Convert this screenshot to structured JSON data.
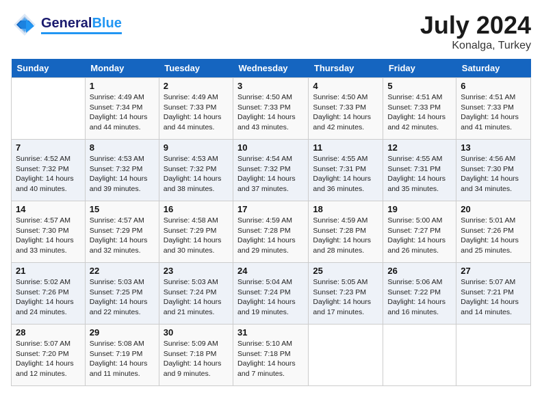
{
  "header": {
    "logo_general": "General",
    "logo_blue": "Blue",
    "month": "July 2024",
    "location": "Konalga, Turkey"
  },
  "days_of_week": [
    "Sunday",
    "Monday",
    "Tuesday",
    "Wednesday",
    "Thursday",
    "Friday",
    "Saturday"
  ],
  "weeks": [
    [
      {
        "day": "",
        "sunrise": "",
        "sunset": "",
        "daylight": ""
      },
      {
        "day": "1",
        "sunrise": "Sunrise: 4:49 AM",
        "sunset": "Sunset: 7:34 PM",
        "daylight": "Daylight: 14 hours and 44 minutes."
      },
      {
        "day": "2",
        "sunrise": "Sunrise: 4:49 AM",
        "sunset": "Sunset: 7:33 PM",
        "daylight": "Daylight: 14 hours and 44 minutes."
      },
      {
        "day": "3",
        "sunrise": "Sunrise: 4:50 AM",
        "sunset": "Sunset: 7:33 PM",
        "daylight": "Daylight: 14 hours and 43 minutes."
      },
      {
        "day": "4",
        "sunrise": "Sunrise: 4:50 AM",
        "sunset": "Sunset: 7:33 PM",
        "daylight": "Daylight: 14 hours and 42 minutes."
      },
      {
        "day": "5",
        "sunrise": "Sunrise: 4:51 AM",
        "sunset": "Sunset: 7:33 PM",
        "daylight": "Daylight: 14 hours and 42 minutes."
      },
      {
        "day": "6",
        "sunrise": "Sunrise: 4:51 AM",
        "sunset": "Sunset: 7:33 PM",
        "daylight": "Daylight: 14 hours and 41 minutes."
      }
    ],
    [
      {
        "day": "7",
        "sunrise": "Sunrise: 4:52 AM",
        "sunset": "Sunset: 7:32 PM",
        "daylight": "Daylight: 14 hours and 40 minutes."
      },
      {
        "day": "8",
        "sunrise": "Sunrise: 4:53 AM",
        "sunset": "Sunset: 7:32 PM",
        "daylight": "Daylight: 14 hours and 39 minutes."
      },
      {
        "day": "9",
        "sunrise": "Sunrise: 4:53 AM",
        "sunset": "Sunset: 7:32 PM",
        "daylight": "Daylight: 14 hours and 38 minutes."
      },
      {
        "day": "10",
        "sunrise": "Sunrise: 4:54 AM",
        "sunset": "Sunset: 7:32 PM",
        "daylight": "Daylight: 14 hours and 37 minutes."
      },
      {
        "day": "11",
        "sunrise": "Sunrise: 4:55 AM",
        "sunset": "Sunset: 7:31 PM",
        "daylight": "Daylight: 14 hours and 36 minutes."
      },
      {
        "day": "12",
        "sunrise": "Sunrise: 4:55 AM",
        "sunset": "Sunset: 7:31 PM",
        "daylight": "Daylight: 14 hours and 35 minutes."
      },
      {
        "day": "13",
        "sunrise": "Sunrise: 4:56 AM",
        "sunset": "Sunset: 7:30 PM",
        "daylight": "Daylight: 14 hours and 34 minutes."
      }
    ],
    [
      {
        "day": "14",
        "sunrise": "Sunrise: 4:57 AM",
        "sunset": "Sunset: 7:30 PM",
        "daylight": "Daylight: 14 hours and 33 minutes."
      },
      {
        "day": "15",
        "sunrise": "Sunrise: 4:57 AM",
        "sunset": "Sunset: 7:29 PM",
        "daylight": "Daylight: 14 hours and 32 minutes."
      },
      {
        "day": "16",
        "sunrise": "Sunrise: 4:58 AM",
        "sunset": "Sunset: 7:29 PM",
        "daylight": "Daylight: 14 hours and 30 minutes."
      },
      {
        "day": "17",
        "sunrise": "Sunrise: 4:59 AM",
        "sunset": "Sunset: 7:28 PM",
        "daylight": "Daylight: 14 hours and 29 minutes."
      },
      {
        "day": "18",
        "sunrise": "Sunrise: 4:59 AM",
        "sunset": "Sunset: 7:28 PM",
        "daylight": "Daylight: 14 hours and 28 minutes."
      },
      {
        "day": "19",
        "sunrise": "Sunrise: 5:00 AM",
        "sunset": "Sunset: 7:27 PM",
        "daylight": "Daylight: 14 hours and 26 minutes."
      },
      {
        "day": "20",
        "sunrise": "Sunrise: 5:01 AM",
        "sunset": "Sunset: 7:26 PM",
        "daylight": "Daylight: 14 hours and 25 minutes."
      }
    ],
    [
      {
        "day": "21",
        "sunrise": "Sunrise: 5:02 AM",
        "sunset": "Sunset: 7:26 PM",
        "daylight": "Daylight: 14 hours and 24 minutes."
      },
      {
        "day": "22",
        "sunrise": "Sunrise: 5:03 AM",
        "sunset": "Sunset: 7:25 PM",
        "daylight": "Daylight: 14 hours and 22 minutes."
      },
      {
        "day": "23",
        "sunrise": "Sunrise: 5:03 AM",
        "sunset": "Sunset: 7:24 PM",
        "daylight": "Daylight: 14 hours and 21 minutes."
      },
      {
        "day": "24",
        "sunrise": "Sunrise: 5:04 AM",
        "sunset": "Sunset: 7:24 PM",
        "daylight": "Daylight: 14 hours and 19 minutes."
      },
      {
        "day": "25",
        "sunrise": "Sunrise: 5:05 AM",
        "sunset": "Sunset: 7:23 PM",
        "daylight": "Daylight: 14 hours and 17 minutes."
      },
      {
        "day": "26",
        "sunrise": "Sunrise: 5:06 AM",
        "sunset": "Sunset: 7:22 PM",
        "daylight": "Daylight: 14 hours and 16 minutes."
      },
      {
        "day": "27",
        "sunrise": "Sunrise: 5:07 AM",
        "sunset": "Sunset: 7:21 PM",
        "daylight": "Daylight: 14 hours and 14 minutes."
      }
    ],
    [
      {
        "day": "28",
        "sunrise": "Sunrise: 5:07 AM",
        "sunset": "Sunset: 7:20 PM",
        "daylight": "Daylight: 14 hours and 12 minutes."
      },
      {
        "day": "29",
        "sunrise": "Sunrise: 5:08 AM",
        "sunset": "Sunset: 7:19 PM",
        "daylight": "Daylight: 14 hours and 11 minutes."
      },
      {
        "day": "30",
        "sunrise": "Sunrise: 5:09 AM",
        "sunset": "Sunset: 7:18 PM",
        "daylight": "Daylight: 14 hours and 9 minutes."
      },
      {
        "day": "31",
        "sunrise": "Sunrise: 5:10 AM",
        "sunset": "Sunset: 7:18 PM",
        "daylight": "Daylight: 14 hours and 7 minutes."
      },
      {
        "day": "",
        "sunrise": "",
        "sunset": "",
        "daylight": ""
      },
      {
        "day": "",
        "sunrise": "",
        "sunset": "",
        "daylight": ""
      },
      {
        "day": "",
        "sunrise": "",
        "sunset": "",
        "daylight": ""
      }
    ]
  ]
}
